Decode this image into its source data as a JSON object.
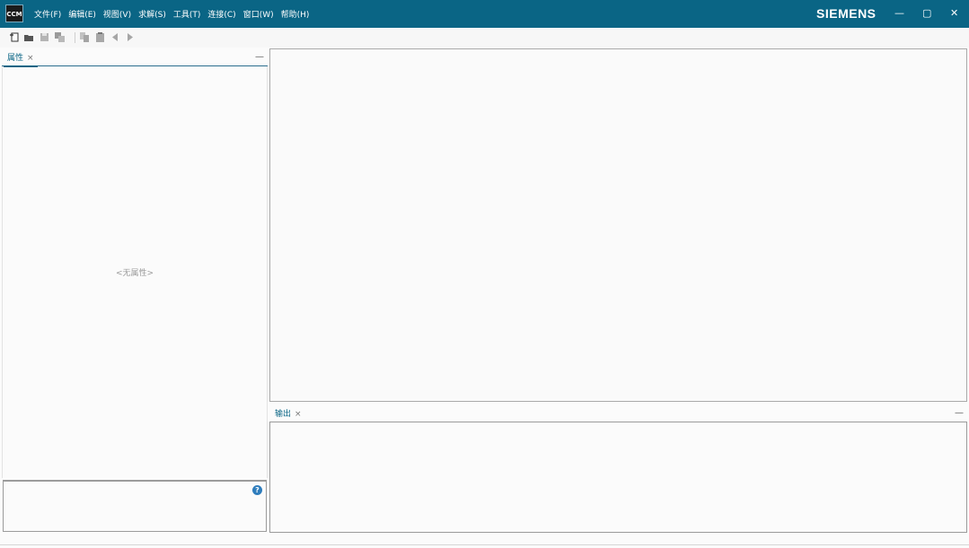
{
  "titlebar": {
    "logo_text": "CCM",
    "menu": [
      "文件(F)",
      "编辑(E)",
      "视图(V)",
      "求解(S)",
      "工具(T)",
      "连接(C)",
      "窗口(W)",
      "帮助(H)"
    ],
    "brand": "SIEMENS",
    "controls": {
      "minimize": "—",
      "maximize": "▢",
      "close": "✕"
    }
  },
  "toolbar": {
    "icons": [
      "new-file-icon",
      "open-folder-icon",
      "save-icon",
      "save-all-icon",
      "copy-icon",
      "paste-icon",
      "back-arrow-icon",
      "forward-arrow-icon"
    ]
  },
  "properties_panel": {
    "tab_label": "属性",
    "close": "×",
    "minimize": "—",
    "empty_text": "<无属性>"
  },
  "description_panel": {
    "help": "?"
  },
  "output_panel": {
    "tab_label": "输出",
    "close": "×",
    "minimize": "—"
  },
  "colors": {
    "titlebar": "#0a6585",
    "accent": "#0a6585"
  }
}
